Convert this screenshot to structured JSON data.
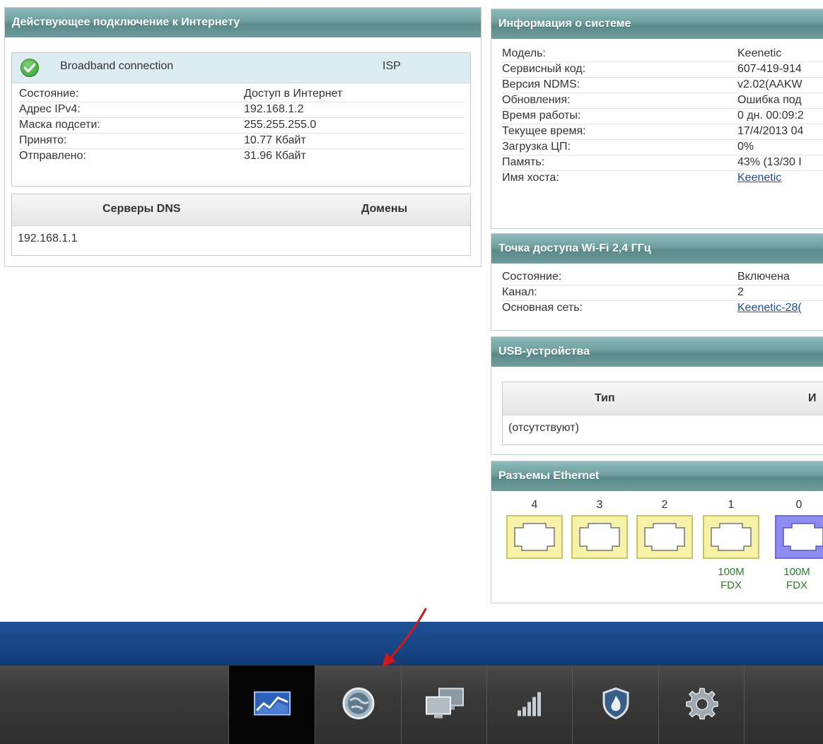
{
  "internet": {
    "title": "Действующее подключение к Интернету",
    "connection_name": "Broadband connection",
    "connection_type": "ISP",
    "rows": [
      {
        "k": "Состояние:",
        "v": "Доступ в Интернет"
      },
      {
        "k": "Адрес IPv4:",
        "v": "192.168.1.2"
      },
      {
        "k": "Маска подсети:",
        "v": "255.255.255.0"
      },
      {
        "k": "Принято:",
        "v": "10.77 Кбайт"
      },
      {
        "k": "Отправлено:",
        "v": "31.96 Кбайт"
      }
    ],
    "dns_header": "Серверы DNS",
    "domains_header": "Домены",
    "dns_server": "192.168.1.1"
  },
  "system": {
    "title": "Информация о системе",
    "rows": [
      {
        "k": "Модель:",
        "v": "Keenetic"
      },
      {
        "k": "Сервисный код:",
        "v": "607-419-914"
      },
      {
        "k": "Версия NDMS:",
        "v": "v2.02(AAKW"
      },
      {
        "k": "Обновления:",
        "v": "Ошибка под"
      },
      {
        "k": "Время работы:",
        "v": "0 дн. 00:09:2"
      },
      {
        "k": "Текущее время:",
        "v": "17/4/2013 04"
      },
      {
        "k": "Загрузка ЦП:",
        "v": "0%"
      },
      {
        "k": "Память:",
        "v": "43% (13/30 I"
      },
      {
        "k": "Имя хоста:",
        "v": "Keenetic"
      }
    ]
  },
  "wifi": {
    "title": "Точка доступа Wi-Fi 2,4 ГГц",
    "rows": [
      {
        "k": "Состояние:",
        "v": "Включена"
      },
      {
        "k": "Канал:",
        "v": "2"
      },
      {
        "k": "Основная сеть:",
        "v": "Keenetic-28("
      }
    ]
  },
  "usb": {
    "title": "USB-устройства",
    "col_type": "Тип",
    "col_name": "И",
    "empty": "(отсутствуют)"
  },
  "ethernet": {
    "title": "Разъемы Ethernet",
    "ports": [
      {
        "label": "4",
        "speed": "",
        "duplex": "",
        "state": "empty"
      },
      {
        "label": "3",
        "speed": "",
        "duplex": "",
        "state": "empty"
      },
      {
        "label": "2",
        "speed": "",
        "duplex": "",
        "state": "empty"
      },
      {
        "label": "1",
        "speed": "100M",
        "duplex": "FDX",
        "state": "lan-active"
      },
      {
        "label": "0",
        "speed": "100M",
        "duplex": "FDX",
        "state": "wan-active"
      }
    ],
    "colors": {
      "lan": "#f6f3a8",
      "lan_border": "#c9c36a",
      "wan": "#8e8cf0"
    }
  },
  "nav": {
    "items": [
      {
        "icon": "monitor-chart-icon",
        "active": true
      },
      {
        "icon": "globe-icon",
        "active": false
      },
      {
        "icon": "computers-icon",
        "active": false
      },
      {
        "icon": "signal-bars-icon",
        "active": false
      },
      {
        "icon": "shield-icon",
        "active": false
      },
      {
        "icon": "gear-icon",
        "active": false
      }
    ]
  }
}
